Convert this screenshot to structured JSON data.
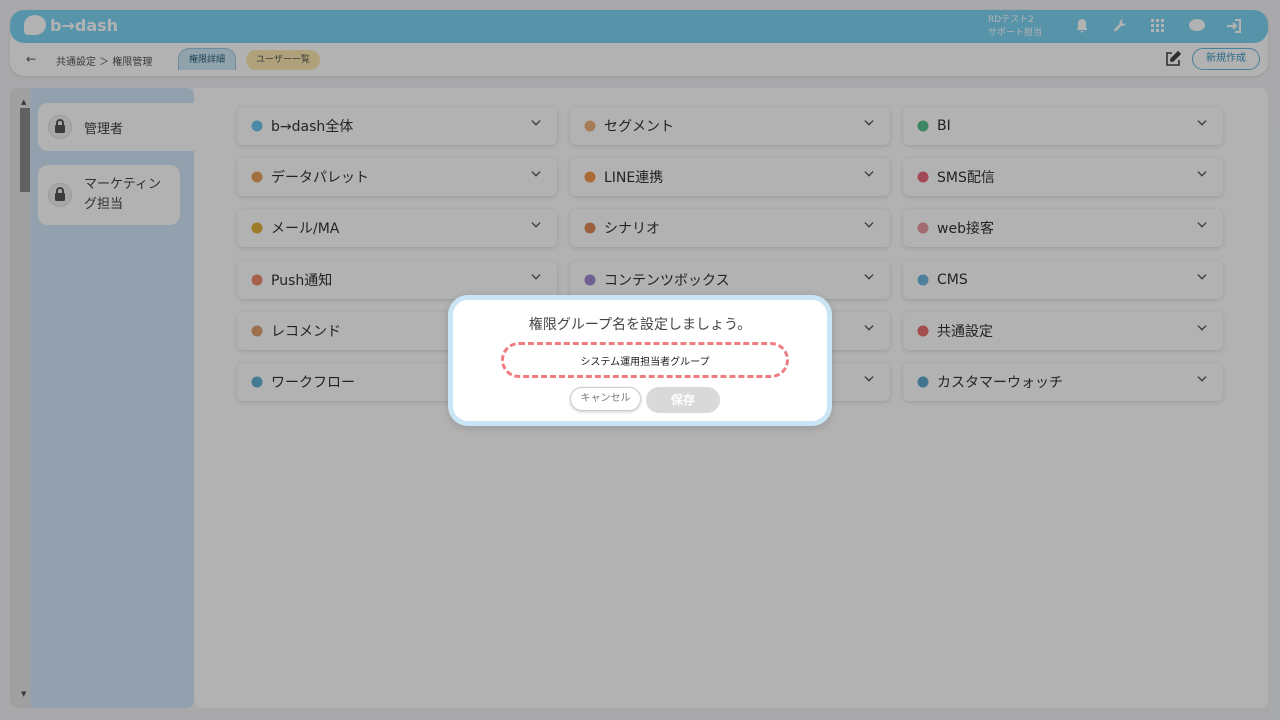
{
  "header": {
    "brand": "b→dash",
    "user_line1": "RDテスト2",
    "user_line2": "サポート担当",
    "icons": [
      "bell-icon",
      "wrench-icon",
      "apps-grid-icon",
      "chat-bubble-icon",
      "logout-icon"
    ]
  },
  "subnav": {
    "back_arrow": "←",
    "breadcrumb": "共通設定 ＞ 権限管理",
    "tab_detail": "権限詳細",
    "tab_users": "ユーザー一覧",
    "new_button": "新規作成"
  },
  "sidebar": {
    "roles": [
      {
        "label": "管理者"
      },
      {
        "label": "マーケティング担当"
      }
    ]
  },
  "features": [
    {
      "label": "b→dash全体",
      "icon": "bdash-icon"
    },
    {
      "label": "セグメント",
      "icon": "segment-icon"
    },
    {
      "label": "BI",
      "icon": "bi-chart-icon"
    },
    {
      "label": "データパレット",
      "icon": "data-palette-icon"
    },
    {
      "label": "LINE連携",
      "icon": "line-icon"
    },
    {
      "label": "SMS配信",
      "icon": "sms-icon"
    },
    {
      "label": "メール/MA",
      "icon": "mail-icon"
    },
    {
      "label": "シナリオ",
      "icon": "scenario-icon"
    },
    {
      "label": "web接客",
      "icon": "web-icon"
    },
    {
      "label": "Push通知",
      "icon": "push-icon"
    },
    {
      "label": "コンテンツボックス",
      "icon": "content-box-icon"
    },
    {
      "label": "CMS",
      "icon": "cms-icon"
    },
    {
      "label": "レコメンド",
      "icon": "recommend-icon"
    },
    {
      "label": "",
      "icon": ""
    },
    {
      "label": "共通設定",
      "icon": "common-settings-icon"
    },
    {
      "label": "ワークフロー",
      "icon": "workflow-icon"
    },
    {
      "label": "",
      "icon": ""
    },
    {
      "label": "カスタマーウォッチ",
      "icon": "customer-watch-icon"
    }
  ],
  "modal": {
    "title": "権限グループ名を設定しましょう。",
    "input_value": "システム運用担当者グループ",
    "cancel_label": "キャンセル",
    "save_label": "保存"
  },
  "colors": {
    "accent": "#7fd4f3",
    "sidebar_bg": "#d3e6f8",
    "input_border": "#f07c82"
  }
}
